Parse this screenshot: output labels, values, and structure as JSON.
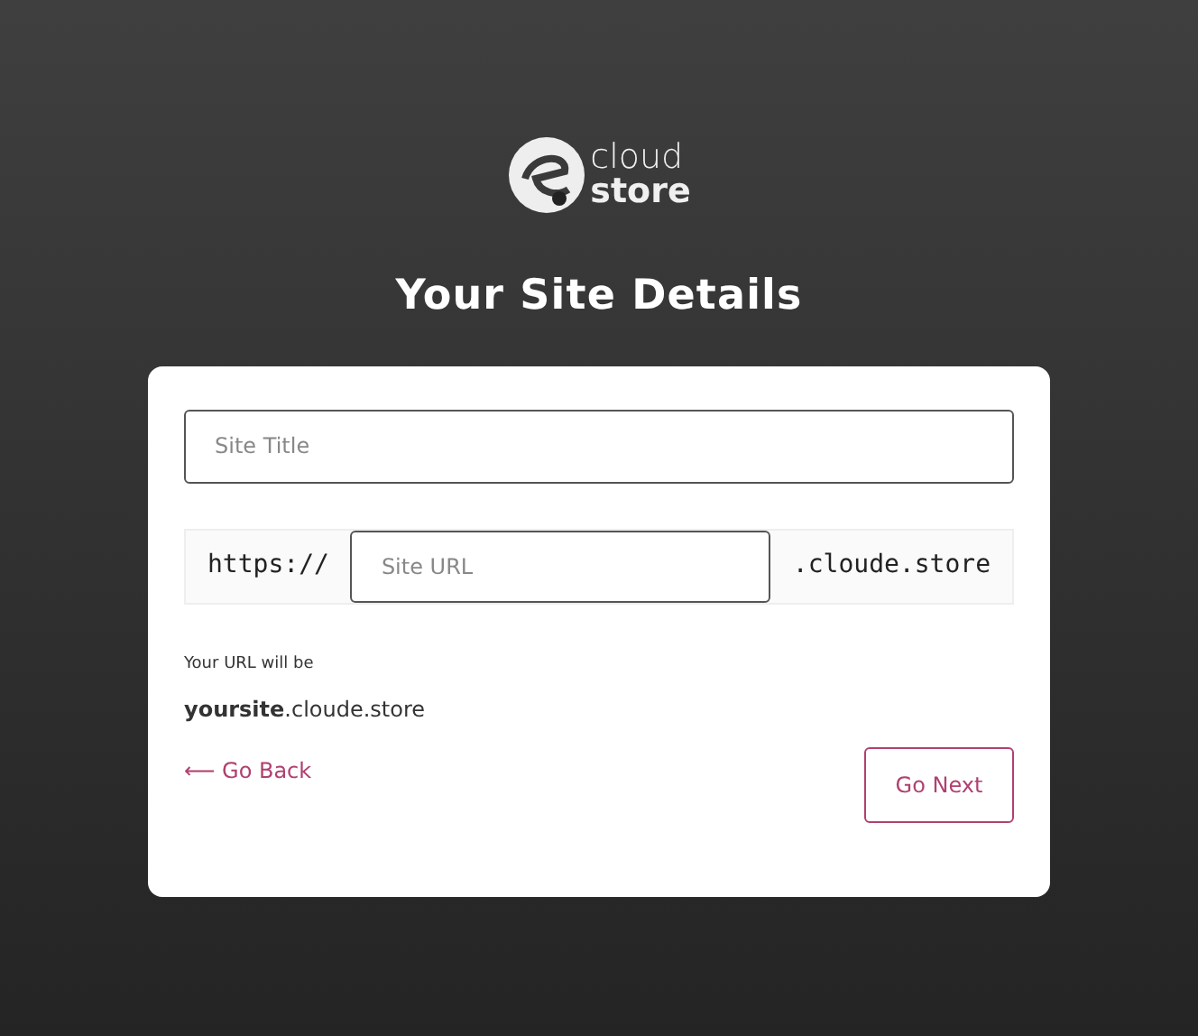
{
  "logo": {
    "line_1": "cloud",
    "line_2": "store"
  },
  "title": "Your Site Details",
  "form": {
    "site_title": {
      "placeholder": "Site Title"
    },
    "site_url": {
      "prefix": "https://",
      "placeholder": "Site URL",
      "suffix": ".cloude.store"
    },
    "preview_label": "Your URL will be",
    "preview_value": "**yoursite**.cloude.store",
    "back_link": "⟵ Go Back",
    "next_button": "Go Next"
  }
}
